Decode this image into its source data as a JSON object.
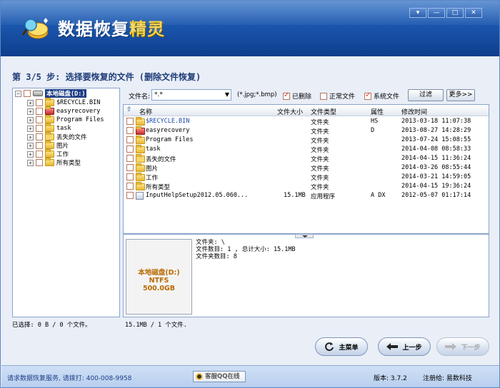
{
  "app": {
    "title_part1": "数据恢复",
    "title_part2": "精灵",
    "window_buttons": [
      "▾",
      "—",
      "□",
      "✕"
    ]
  },
  "step_title": "第 3/5 步: 选择要恢复的文件 (删除文件恢复)",
  "tree": {
    "root_label": "本地磁盘(D:)",
    "items": [
      {
        "label": "$RECYCLE.BIN"
      },
      {
        "label": "easyrecovery"
      },
      {
        "label": "Program Files"
      },
      {
        "label": "task"
      },
      {
        "label": "丢失的文件"
      },
      {
        "label": "图片"
      },
      {
        "label": "工作"
      },
      {
        "label": "所有类型"
      }
    ]
  },
  "toolbar": {
    "filename_label": "文件名:",
    "filename_value": "*.*",
    "hint": "(*.jpg;*.bmp)",
    "deleted_label": "已删除",
    "normal_label": "正常文件",
    "system_label": "系统文件",
    "filter_button": "过滤",
    "more_button": "更多>>"
  },
  "file_list": {
    "columns": [
      "名称",
      "文件大小",
      "文件类型",
      "属性",
      "修改时间"
    ],
    "rows": [
      {
        "name": "$RECYCLE.BIN",
        "size": "",
        "type": "文件夹",
        "attr": "HS",
        "time": "2013-03-18 11:07:38"
      },
      {
        "name": "easyrecovery",
        "size": "",
        "type": "文件夹",
        "attr": "D",
        "time": "2013-08-27 14:28:29"
      },
      {
        "name": "Program Files",
        "size": "",
        "type": "文件夹",
        "attr": "",
        "time": "2013-07-24 15:08:55"
      },
      {
        "name": "task",
        "size": "",
        "type": "文件夹",
        "attr": "",
        "time": "2014-04-08 08:58:33"
      },
      {
        "name": "丢失的文件",
        "size": "",
        "type": "文件夹",
        "attr": "",
        "time": "2014-04-15 11:36:24"
      },
      {
        "name": "图片",
        "size": "",
        "type": "文件夹",
        "attr": "",
        "time": "2014-03-26 08:55:44"
      },
      {
        "name": "工作",
        "size": "",
        "type": "文件夹",
        "attr": "",
        "time": "2014-03-21 14:59:05"
      },
      {
        "name": "所有类型",
        "size": "",
        "type": "文件夹",
        "attr": "",
        "time": "2014-04-15 19:36:24"
      },
      {
        "name": "InputHelpSetup2012.05.060...",
        "size": "15.1MB",
        "type": "应用程序",
        "attr": "A DX",
        "time": "2012-05-07 01:17:14"
      }
    ]
  },
  "disk_card": {
    "name": "本地磁盘(D:)",
    "fs": "NTFS",
    "size": "500.0GB"
  },
  "info": {
    "line1": "文件夹: \\",
    "line2": "文件数目: 1 , 总计大小: 15.1MB",
    "line3": "文件夹数目: 8"
  },
  "status": {
    "selected": "已选择: 0 B / 0 个文件。",
    "total": "15.1MB / 1 个文件."
  },
  "nav": {
    "main_menu": "主菜单",
    "prev": "上一步",
    "next": "下一步"
  },
  "footer": {
    "service": "请求数据恢复服务, 请拨打: 400-008-9958",
    "qq": "客服QQ在线",
    "version": "版本: 3.7.2",
    "registered": "注册给: 易数科技"
  }
}
